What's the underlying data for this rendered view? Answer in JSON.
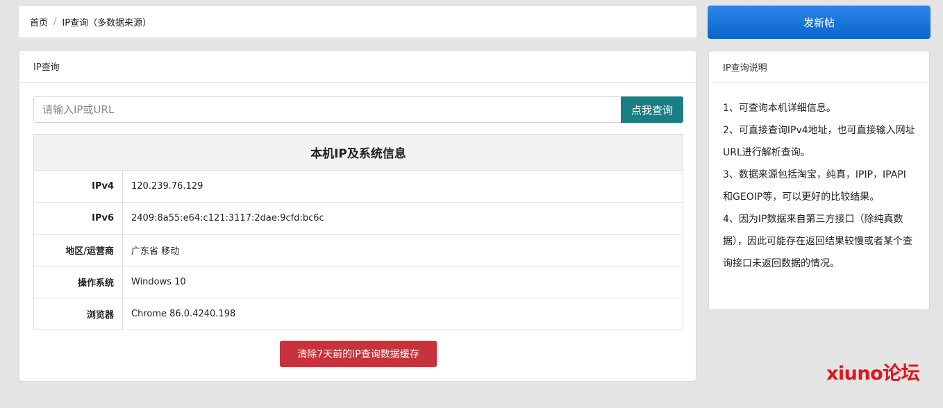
{
  "breadcrumb": {
    "home": "首页",
    "separator": "/",
    "current": "IP查询（多数据来源）"
  },
  "main_card": {
    "header": "IP查询",
    "search": {
      "placeholder": "请输入IP或URL",
      "value": "",
      "button_label": "点我查询"
    },
    "table": {
      "title": "本机IP及系统信息",
      "rows": [
        {
          "label": "IPv4",
          "value": "120.239.76.129"
        },
        {
          "label": "IPv6",
          "value": "2409:8a55:e64:c121:3117:2dae:9cfd:bc6c"
        },
        {
          "label": "地区/运营商",
          "value": "广东省 移动"
        },
        {
          "label": "操作系统",
          "value": "Windows 10"
        },
        {
          "label": "浏览器",
          "value": "Chrome 86.0.4240.198"
        }
      ]
    },
    "clear_button_label": "清除7天前的IP查询数据缓存"
  },
  "sidebar": {
    "new_post_label": "发新帖",
    "notes_header": "IP查询说明",
    "notes": [
      "1、可查询本机详细信息。",
      "2、可直接查询IPv4地址，也可直接输入网址URL进行解析查询。",
      "3、数据来源包括淘宝，纯真，IPIP，IPAPI和GEOIP等，可以更好的比较结果。",
      "4、因为IP数据来自第三方接口（除纯真数据），因此可能存在返回结果较慢或者某个查询接口未返回数据的情况。"
    ]
  },
  "watermark": "xiuno论坛",
  "colors": {
    "search_button": "#1a7f85",
    "clear_button": "#c8323c",
    "new_post_button": "#0b63cf",
    "watermark": "#e0141e"
  }
}
